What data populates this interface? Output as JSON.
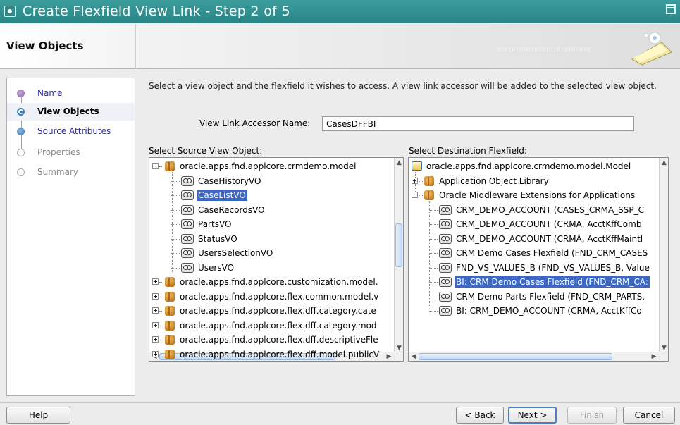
{
  "window": {
    "title": "Create Flexfield View Link - Step 2 of 5"
  },
  "header": {
    "page_title": "View Objects",
    "binary_decoration": "0101010101010101010101010"
  },
  "steps": [
    {
      "label": "Name",
      "state": "done"
    },
    {
      "label": "View Objects",
      "state": "current"
    },
    {
      "label": "Source Attributes",
      "state": "next"
    },
    {
      "label": "Properties",
      "state": "todo"
    },
    {
      "label": "Summary",
      "state": "todo"
    }
  ],
  "main": {
    "instructions": "Select a view object and the flexfield it wishes to access. A view link accessor will be added to the selected view object.",
    "accessor_label": "View Link Accessor Name:",
    "accessor_value": "CasesDFFBI",
    "source_label": "Select Source View Object:",
    "dest_label": "Select Destination Flexfield:"
  },
  "source_tree": [
    {
      "text": "oracle.apps.fnd.applcore.crmdemo.model",
      "kind": "package",
      "level": 0,
      "expander": "minus"
    },
    {
      "text": "CaseHistoryVO",
      "kind": "vo",
      "level": 1
    },
    {
      "text": "CaseListVO",
      "kind": "vo",
      "level": 1,
      "selected": true
    },
    {
      "text": "CaseRecordsVO",
      "kind": "vo",
      "level": 1
    },
    {
      "text": "PartsVO",
      "kind": "vo",
      "level": 1
    },
    {
      "text": "StatusVO",
      "kind": "vo",
      "level": 1
    },
    {
      "text": "UsersSelectionVO",
      "kind": "vo",
      "level": 1
    },
    {
      "text": "UsersVO",
      "kind": "vo",
      "level": 1
    },
    {
      "text": "oracle.apps.fnd.applcore.customization.model.",
      "kind": "package",
      "level": 0,
      "expander": "plus"
    },
    {
      "text": "oracle.apps.fnd.applcore.flex.common.model.v",
      "kind": "package",
      "level": 0,
      "expander": "plus"
    },
    {
      "text": "oracle.apps.fnd.applcore.flex.dff.category.cate",
      "kind": "package",
      "level": 0,
      "expander": "plus"
    },
    {
      "text": "oracle.apps.fnd.applcore.flex.dff.category.mod",
      "kind": "package",
      "level": 0,
      "expander": "plus"
    },
    {
      "text": "oracle.apps.fnd.applcore.flex.dff.descriptiveFle",
      "kind": "package",
      "level": 0,
      "expander": "plus"
    },
    {
      "text": "oracle.apps.fnd.applcore.flex.dff.model.publicV",
      "kind": "package",
      "level": 0,
      "expander": "plus"
    }
  ],
  "dest_tree": [
    {
      "text": "oracle.apps.fnd.applcore.crmdemo.model.Model",
      "kind": "folder",
      "level": 0
    },
    {
      "text": "Application Object Library",
      "kind": "package",
      "level": 1,
      "expander": "plus"
    },
    {
      "text": "Oracle Middleware Extensions for Applications",
      "kind": "package",
      "level": 1,
      "expander": "minus"
    },
    {
      "text": "CRM_DEMO_ACCOUNT (CASES_CRMA_SSP_C",
      "kind": "vo",
      "level": 2
    },
    {
      "text": "CRM_DEMO_ACCOUNT (CRMA, AcctKffComb",
      "kind": "vo",
      "level": 2
    },
    {
      "text": "CRM_DEMO_ACCOUNT (CRMA, AcctKffMaintl",
      "kind": "vo",
      "level": 2
    },
    {
      "text": "CRM Demo Cases Flexfield (FND_CRM_CASES",
      "kind": "vo",
      "level": 2
    },
    {
      "text": "FND_VS_VALUES_B (FND_VS_VALUES_B, Value",
      "kind": "vo",
      "level": 2
    },
    {
      "text": "BI: CRM Demo Cases Flexfield (FND_CRM_CA:",
      "kind": "vo",
      "level": 2,
      "selected": true
    },
    {
      "text": "CRM Demo Parts Flexfield (FND_CRM_PARTS,",
      "kind": "vo",
      "level": 2
    },
    {
      "text": "BI: CRM_DEMO_ACCOUNT (CRMA, AcctKffCo",
      "kind": "vo",
      "level": 2
    }
  ],
  "buttons": {
    "help": "Help",
    "back": "< Back",
    "next": "Next >",
    "finish": "Finish",
    "cancel": "Cancel"
  },
  "colors": {
    "titlebar": "#2a8686",
    "selection": "#3a68c4",
    "link": "#2a2ab0"
  }
}
